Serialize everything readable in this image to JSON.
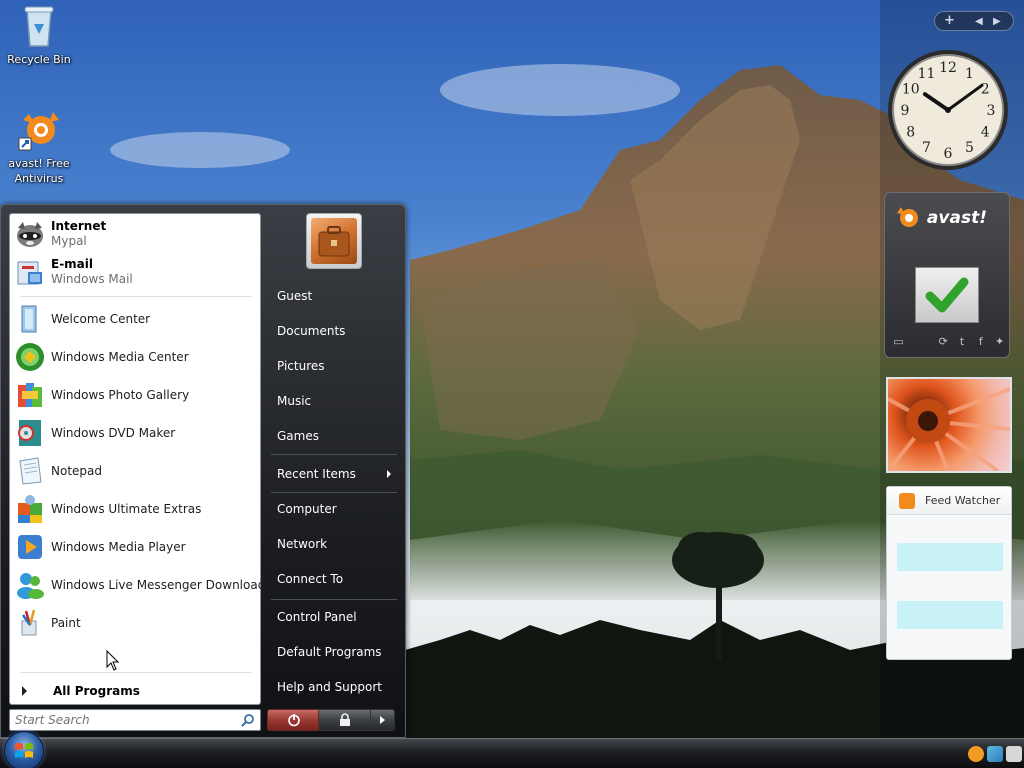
{
  "desktop": {
    "icons": [
      {
        "label": "Recycle Bin",
        "icon": "recycle-bin-icon"
      },
      {
        "label": "avast! Free Antivirus",
        "icon": "avast-icon"
      }
    ]
  },
  "start_menu": {
    "pinned": [
      {
        "title": "Internet",
        "subtitle": "Mypal",
        "icon": "raccoon-browser-icon"
      },
      {
        "title": "E-mail",
        "subtitle": "Windows Mail",
        "icon": "mail-icon"
      }
    ],
    "recent": [
      {
        "label": "Welcome Center",
        "icon": "welcome-center-icon"
      },
      {
        "label": "Windows Media Center",
        "icon": "media-center-icon"
      },
      {
        "label": "Windows Photo Gallery",
        "icon": "photo-gallery-icon"
      },
      {
        "label": "Windows DVD Maker",
        "icon": "dvd-maker-icon"
      },
      {
        "label": "Notepad",
        "icon": "notepad-icon"
      },
      {
        "label": "Windows Ultimate Extras",
        "icon": "ultimate-extras-icon"
      },
      {
        "label": "Windows Media Player",
        "icon": "media-player-icon"
      },
      {
        "label": "Windows Live Messenger Download",
        "icon": "messenger-icon"
      },
      {
        "label": "Paint",
        "icon": "paint-icon"
      }
    ],
    "all_programs": "All Programs",
    "search_placeholder": "Start Search",
    "right_links": [
      {
        "label": "Guest"
      },
      {
        "label": "Documents"
      },
      {
        "label": "Pictures"
      },
      {
        "label": "Music"
      },
      {
        "label": "Games"
      },
      {
        "label": "Recent Items",
        "submenu": true
      },
      {
        "label": "Computer"
      },
      {
        "label": "Network"
      },
      {
        "label": "Connect To"
      },
      {
        "label": "Control Panel"
      },
      {
        "label": "Default Programs"
      },
      {
        "label": "Help and Support"
      }
    ]
  },
  "gadgets": {
    "clock": {
      "hour": 10,
      "minute": 9,
      "numerals": [
        "12",
        "1",
        "2",
        "3",
        "4",
        "5",
        "6",
        "7",
        "8",
        "9",
        "10",
        "11"
      ]
    },
    "avast": {
      "logo": "avast!",
      "status": "check-icon"
    },
    "feed": {
      "title": "Feed Watcher"
    }
  },
  "colors": {
    "start_menu_dark": "#1c1e22",
    "avast_orange": "#f28a1e",
    "feed_item": "#c8f1f8"
  }
}
